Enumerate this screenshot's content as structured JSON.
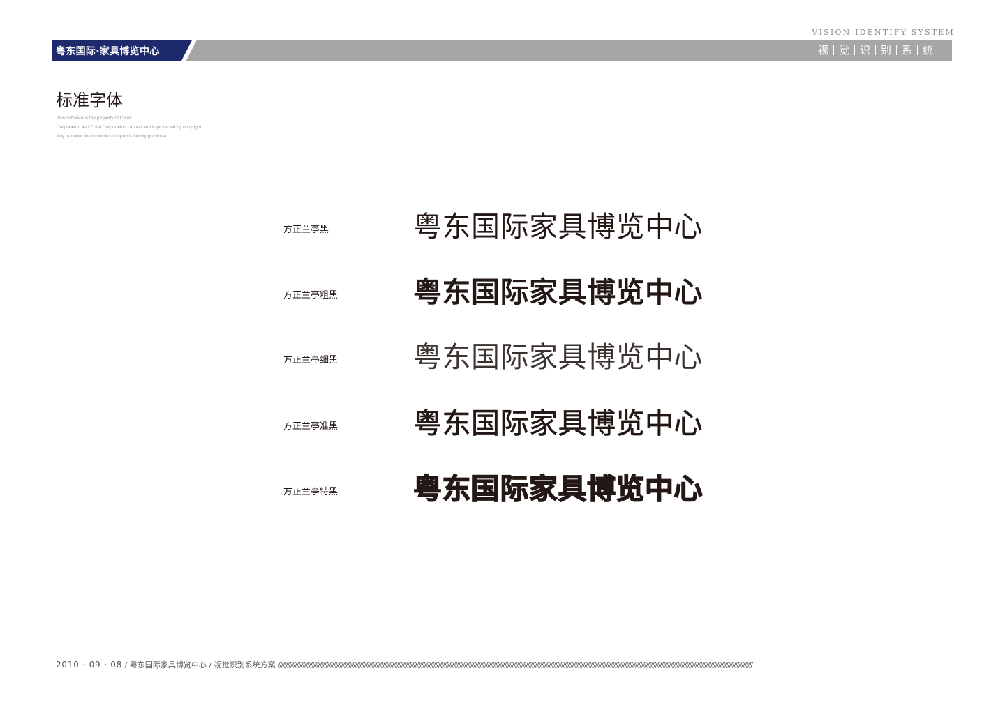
{
  "header": {
    "brand": "粤东国际·家具博览中心",
    "system_en": "VISION IDENTIFY SYSTEM",
    "system_cn": [
      "视",
      "觉",
      "识",
      "别",
      "系",
      "统"
    ]
  },
  "section": {
    "title": "标准字体",
    "fine_print": [
      "This software is the property of Corel",
      "Corporation and Corel Corporation Limited and is protected by copyright.",
      "Any reproduction in whole or in part is strictly prohibited."
    ]
  },
  "samples": [
    {
      "font": "方正兰亭黑",
      "text": "粤东国际家具博览中心"
    },
    {
      "font": "方正兰亭粗黑",
      "text": "粤东国际家具博览中心"
    },
    {
      "font": "方正兰亭细黑",
      "text": "粤东国际家具博览中心"
    },
    {
      "font": "方正兰亭准黑",
      "text": "粤东国际家具博览中心"
    },
    {
      "font": "方正兰亭特黑",
      "text": "粤东国际家具博览中心"
    }
  ],
  "footer": {
    "date": "2010 · 09 · 08",
    "title": " / 粤东国际家具博览中心 / 视觉识别系统方案 ",
    "slashes": "////////////////////////////////////////////////////////////////////////////////////////////////////////////////////////////////////////////////////////////////////////////////////////////////////////////////////////////////////////////////////////////////////////////////////////////////////////////////////"
  },
  "colors": {
    "brand_navy": "#1d2a6b",
    "header_gray": "#a6a6a6",
    "text_dark": "#231815"
  }
}
